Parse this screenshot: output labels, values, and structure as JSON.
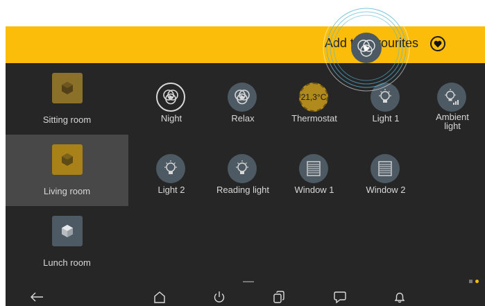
{
  "header": {
    "favourites_label": "Add to favourites"
  },
  "rooms": [
    {
      "label": "Sitting room"
    },
    {
      "label": "Living room"
    },
    {
      "label": "Lunch room"
    }
  ],
  "tiles": [
    {
      "label": "Night"
    },
    {
      "label": "Relax"
    },
    {
      "label": "Thermostat",
      "value": "21,3°C"
    },
    {
      "label": "Light 1"
    },
    {
      "label": "Ambient light"
    },
    {
      "label": "Light 2"
    },
    {
      "label": "Reading light"
    },
    {
      "label": "Window 1"
    },
    {
      "label": "Window 2"
    }
  ],
  "colors": {
    "accent": "#fbbd09",
    "background": "#262626",
    "active_room": "#484848",
    "tile_icon": "#4d5a63"
  },
  "icons": {
    "header": "heart-icon",
    "nav": [
      "back-arrow-icon",
      "home-icon",
      "power-icon",
      "copy-icon",
      "message-icon",
      "bell-icon"
    ]
  }
}
